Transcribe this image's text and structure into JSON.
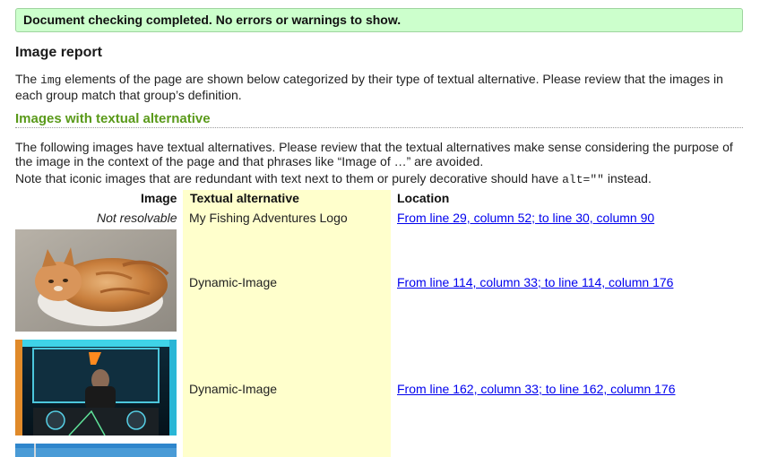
{
  "banner": {
    "text": "Document checking completed. No errors or warnings to show."
  },
  "report": {
    "title": "Image report",
    "intro_before": "The ",
    "intro_code": "img",
    "intro_after": " elements of the page are shown below categorized by their type of textual alternative. Please review that the images in each group match that group’s definition."
  },
  "section": {
    "title": "Images with textual alternative",
    "desc": "The following images have textual alternatives. Please review that the textual alternatives make sense considering the purpose of the image in the context of the page and that phrases like “Image of …” are avoided.",
    "note_before": "Note that iconic images that are redundant with text next to them or purely decorative should have ",
    "note_code": "alt=\"\"",
    "note_after": " instead."
  },
  "table": {
    "headers": {
      "image": "Image",
      "alt": "Textual alternative",
      "location": "Location"
    },
    "rows": [
      {
        "image_text": "Not resolvable",
        "image_icon": "",
        "alt": "My Fishing Adventures Logo",
        "location": "From line 29, column 52; to line 30, column 90"
      },
      {
        "image_text": "",
        "image_icon": "cat-photo",
        "alt": "Dynamic-Image",
        "location": "From line 114, column 33; to line 114, column 176"
      },
      {
        "image_text": "",
        "image_icon": "dj-photo",
        "alt": "Dynamic-Image",
        "location": "From line 162, column 33; to line 162, column 176"
      }
    ]
  },
  "colors": {
    "banner_bg": "#ccffcc",
    "section_title": "#5a9a1a",
    "alt_column_bg": "#ffffcc",
    "link": "#0000ee"
  }
}
